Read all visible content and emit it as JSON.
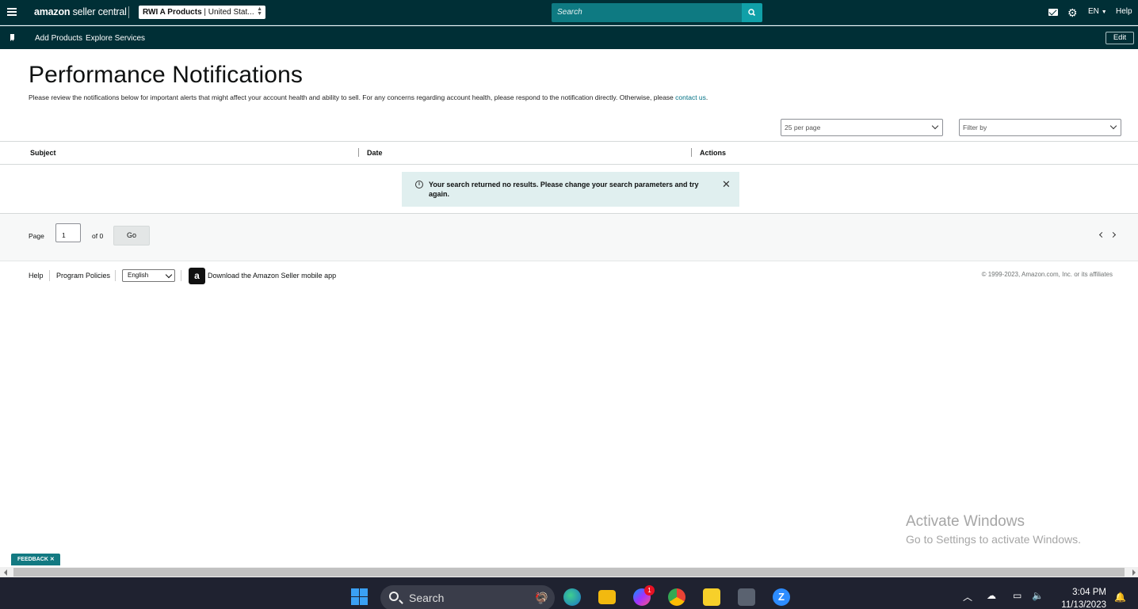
{
  "header": {
    "logo_brand": "amazon",
    "logo_product": "seller central",
    "account_name": "RWI A Products",
    "account_region": "| United Stat...",
    "search_placeholder": "Search",
    "language": "EN",
    "help": "Help"
  },
  "subnav": {
    "items": [
      "Add Products",
      "Explore Services"
    ],
    "edit_label": "Edit"
  },
  "page": {
    "title": "Performance Notifications",
    "description": "Please review the notifications below for important alerts that might affect your account health and ability to sell. For any concerns regarding account health, please respond to the notification directly. Otherwise, please",
    "contact_link": "contact us",
    "description_end": "."
  },
  "filters": {
    "per_page": "25 per page",
    "filter_placeholder": "Filter by"
  },
  "table": {
    "columns": [
      "Subject",
      "Date",
      "Actions"
    ],
    "empty_message": "Your search returned no results. Please change your search parameters and try again."
  },
  "pagination": {
    "page_label": "Page",
    "current_page": "1",
    "of_label": "of 0",
    "go_label": "Go"
  },
  "footer": {
    "links": [
      "Help",
      "Program Policies"
    ],
    "language": "English",
    "app_text": "Download the Amazon Seller mobile app",
    "copyright": "© 1999-2023, Amazon.com, Inc. or its affiliates"
  },
  "overlay": {
    "activate_title": "Activate Windows",
    "activate_sub": "Go to Settings to activate Windows.",
    "feedback": "FEEDBACK"
  },
  "taskbar": {
    "search": "Search",
    "messenger_badge": "1",
    "time": "3:04 PM",
    "date": "11/13/2023"
  },
  "colors": {
    "header_bg": "#002f36",
    "search_bg": "#0e7a82",
    "accent": "#007185",
    "alert_bg": "#e0efef"
  }
}
